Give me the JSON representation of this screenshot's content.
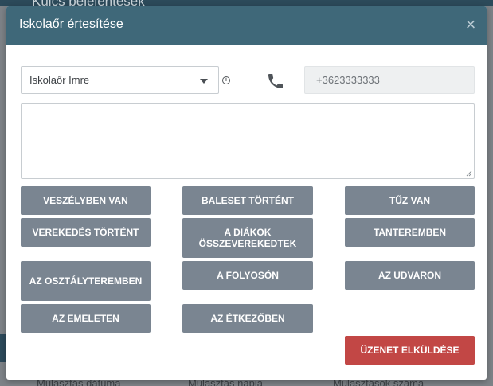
{
  "background": {
    "page_title": "Kulcs bejelentések",
    "columns": [
      "Mulasztás dátuma",
      "Mulasztás napja",
      "Mulasztások száma"
    ]
  },
  "dialog": {
    "title": "Iskolaőr értesítése",
    "close_icon": "×",
    "recipient": {
      "selected": "Iskolaőr Imre"
    },
    "info_icon": "i",
    "phone": {
      "value": "+3623333333"
    },
    "message": {
      "value": ""
    },
    "quick_messages": [
      "VESZÉLYBEN VAN",
      "BALESET TÖRTÉNT",
      "TŰZ VAN",
      "VEREKEDÉS TÖRTÉNT",
      "A DIÁKOK ÖSSZEVEREKEDTEK",
      "TANTEREMBEN",
      "AZ OSZTÁLYTEREMBEN",
      "A FOLYOSÓN",
      "AZ UDVARON",
      "AZ EMELETEN",
      "AZ ÉTKEZŐBEN"
    ],
    "send_label": "ÜZENET ELKÜLDÉSE"
  },
  "colors": {
    "header": "#3f6879",
    "quick_button": "#7a8591",
    "send_button": "#c24745"
  }
}
